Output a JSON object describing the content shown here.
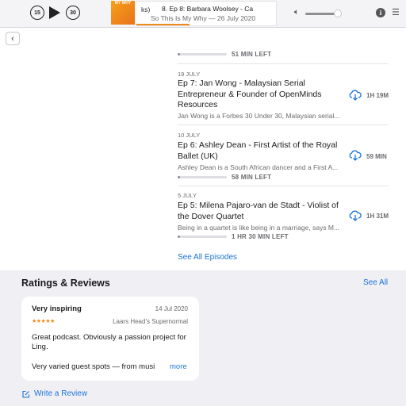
{
  "player": {
    "skip_back_seconds": "15",
    "skip_forward_seconds": "30",
    "artwork_text": "MY WHY",
    "lead_text": "ks)",
    "now_playing_title": "8. Ep 8: Barbara Woolsey - Ca",
    "now_playing_subtitle": "So This Is My Why — 26 July 2020",
    "playback_progress": 0.38,
    "volume": 0.9
  },
  "nav": {
    "back_symbol": "‹"
  },
  "episodes_top_progress": {
    "progress": 0.05,
    "time_left": "51 MIN LEFT"
  },
  "episodes": [
    {
      "date": "19 JULY",
      "title": "Ep 7: Jan Wong - Malaysian Serial Entrepreneur & Founder of OpenMinds Resources",
      "description": "Jan Wong is a Forbes 30 Under 30, Malaysian serial...",
      "duration": "1H 19M"
    },
    {
      "date": "10 JULY",
      "title": "Ep 6: Ashley Dean - First Artist of the Royal Ballet (UK)",
      "description": "Ashley Dean is a South African dancer and a First A...",
      "duration": "59 MIN",
      "progress": 0.05,
      "time_left": "58 MIN LEFT"
    },
    {
      "date": "5 JULY",
      "title": "Ep 5: Milena Pajaro-van de Stadt - Violist of the Dover Quartet",
      "description": "Being in a quartet is like being in a marriage, says M...",
      "duration": "1H 31M",
      "progress": 0.05,
      "time_left": "1 HR 30 MIN LEFT"
    }
  ],
  "see_all_episodes": "See All Episodes",
  "ratings": {
    "title": "Ratings & Reviews",
    "see_all": "See All",
    "review": {
      "title": "Very inspiring",
      "date": "14 Jul 2020",
      "stars": "★★★★★",
      "author": "Laars Head's Supernormal",
      "body_line1": "Great podcast.  Obviously a passion project for Ling.",
      "body_line2": "Very varied guest spots — from musi",
      "more": "more"
    },
    "write_review": "Write a Review"
  },
  "colors": {
    "accent": "#1a73d9",
    "brand_orange": "#f08a1c",
    "secondary_text": "#6b6b70"
  }
}
